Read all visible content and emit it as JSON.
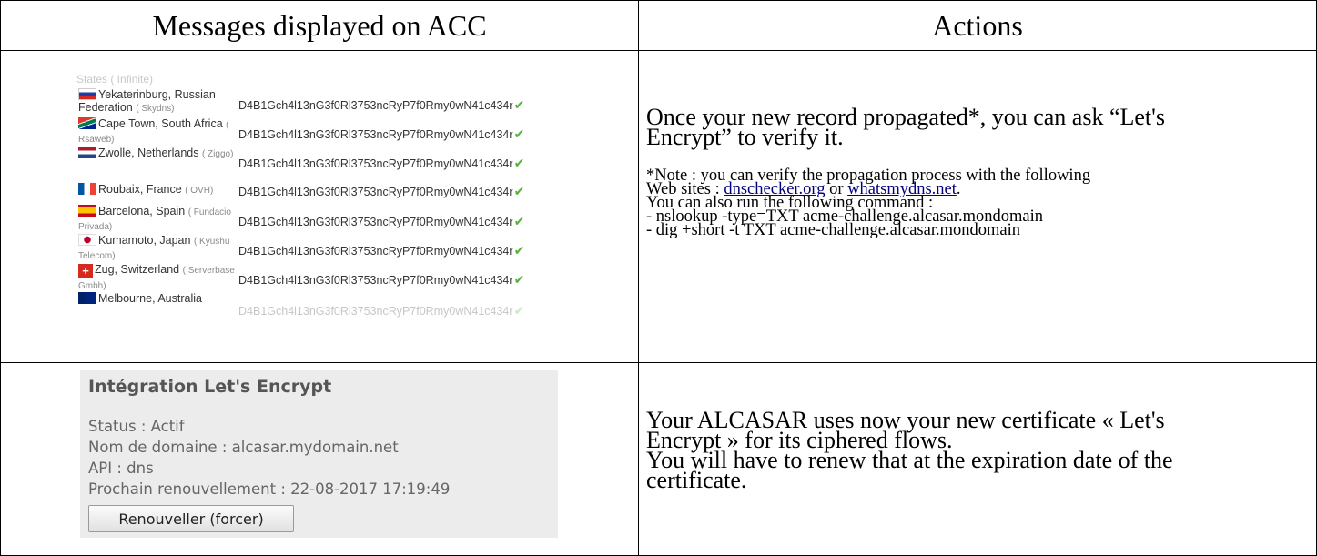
{
  "headers": {
    "col1": "Messages displayed on ACC",
    "col2": "Actions"
  },
  "dns_list": {
    "faded_top_label": "States ( Infinite)",
    "rows": [
      {
        "location": "Yekaterinburg, Russian Federation",
        "isp": "( Skydns)",
        "flag": "russia-flag-icon",
        "value": "D4B1Gch4l13nG3f0Rl3753ncRyP7f0Rmy0wN41c434r"
      },
      {
        "location": "Cape Town, South Africa",
        "isp": "( Rsaweb)",
        "flag": "south-africa-flag-icon",
        "value": "D4B1Gch4l13nG3f0Rl3753ncRyP7f0Rmy0wN41c434r"
      },
      {
        "location": "Zwolle, Netherlands",
        "isp": "( Ziggo)",
        "flag": "netherlands-flag-icon",
        "value": "D4B1Gch4l13nG3f0Rl3753ncRyP7f0Rmy0wN41c434r"
      },
      {
        "location": "Roubaix, France",
        "isp": "( OVH)",
        "flag": "france-flag-icon",
        "value": "D4B1Gch4l13nG3f0Rl3753ncRyP7f0Rmy0wN41c434r"
      },
      {
        "location": "Barcelona, Spain",
        "isp": "( Fundacio Privada)",
        "flag": "spain-flag-icon",
        "value": "D4B1Gch4l13nG3f0Rl3753ncRyP7f0Rmy0wN41c434r"
      },
      {
        "location": "Kumamoto, Japan",
        "isp": "( Kyushu Telecom)",
        "flag": "japan-flag-icon",
        "value": "D4B1Gch4l13nG3f0Rl3753ncRyP7f0Rmy0wN41c434r"
      },
      {
        "location": "Zug, Switzerland",
        "isp": "( Serverbase Gmbh)",
        "flag": "switzerland-flag-icon",
        "value": "D4B1Gch4l13nG3f0Rl3753ncRyP7f0Rmy0wN41c434r"
      },
      {
        "location": "Melbourne, Australia",
        "isp": "",
        "flag": "australia-flag-icon",
        "value": "D4B1Gch4l13nG3f0Rl3753ncRyP7f0Rmy0wN41c434r"
      }
    ]
  },
  "action1": {
    "line1": "Once your new record propagated*, you can ask “Let's",
    "line2": "Encrypt” to verify it.",
    "note_line1": "*Note : you can verify the propagation process with the following",
    "note_prefix": "Web sites : ",
    "link1": "dnschecker.org",
    "note_or": " or ",
    "link2": "whatsmydns.net",
    "note_end": ".",
    "note_line3": "You can also run the following command :",
    "cmd1": "- nslookup -type=TXT acme-challenge.alcasar.mondomain",
    "cmd2": "- dig +short -t TXT acme-challenge.alcasar.mondomain"
  },
  "panel": {
    "title": "Intégration Let's Encrypt",
    "status": "Status : Actif",
    "domain": "Nom de domaine : alcasar.mydomain.net",
    "api": "API : dns",
    "renewal": "Prochain renouvellement : 22-08-2017 17:19:49",
    "button": "Renouveller (forcer)"
  },
  "action2": {
    "line1": "Your ALCASAR uses now your new certificate « Let's",
    "line2": "Encrypt » for its ciphered flows.",
    "line3": "You will have to renew that at the expiration date of the",
    "line4": "certificate."
  },
  "colors": {
    "check": "#55b23b",
    "link": "#000080",
    "panel_bg": "#ececec"
  }
}
